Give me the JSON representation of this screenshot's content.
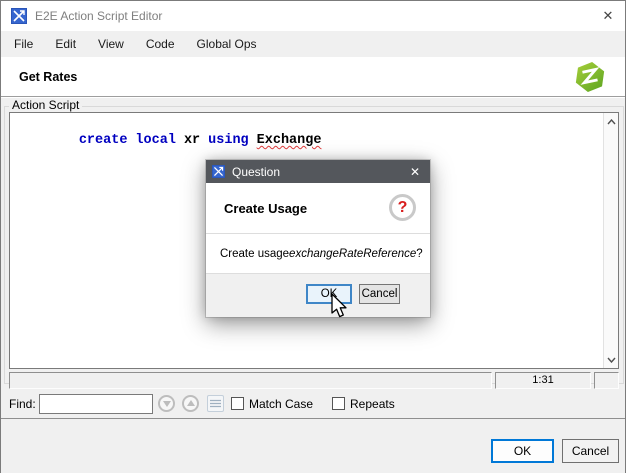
{
  "window": {
    "title": "E2E Action Script Editor",
    "close_glyph": "✕"
  },
  "menu": {
    "items": [
      "File",
      "Edit",
      "View",
      "Code",
      "Global Ops"
    ]
  },
  "header": {
    "title": "Get Rates"
  },
  "action_script": {
    "group_label": "Action Script",
    "code_tokens": [
      {
        "text": "create",
        "type": "keyword"
      },
      {
        "text": "local",
        "type": "keyword"
      },
      {
        "text": "xr",
        "type": "identifier"
      },
      {
        "text": "using",
        "type": "keyword"
      },
      {
        "text": "Exchange",
        "type": "identifier-misspelled"
      }
    ],
    "status": {
      "caret_position": "1:31"
    }
  },
  "find_bar": {
    "label": "Find:",
    "input_value": "",
    "match_case_label": "Match Case",
    "repeats_label": "Repeats"
  },
  "footer": {
    "ok_label": "OK",
    "cancel_label": "Cancel"
  },
  "dialog": {
    "title": "Question",
    "close_glyph": "✕",
    "heading": "Create Usage",
    "help_glyph": "?",
    "message": {
      "prefix": "Create usage ",
      "emphasis": "exchangeRateReference",
      "suffix": "?"
    },
    "ok_label": "OK",
    "cancel_label": "Cancel"
  },
  "colors": {
    "keyword_blue": "#0000c0",
    "error_red": "#e03c3c",
    "dialog_titlebar_gray": "#54575c",
    "accent_blue": "#0078d7",
    "logo_green": "#76b82a",
    "panel_gray": "#f0f0f0"
  }
}
